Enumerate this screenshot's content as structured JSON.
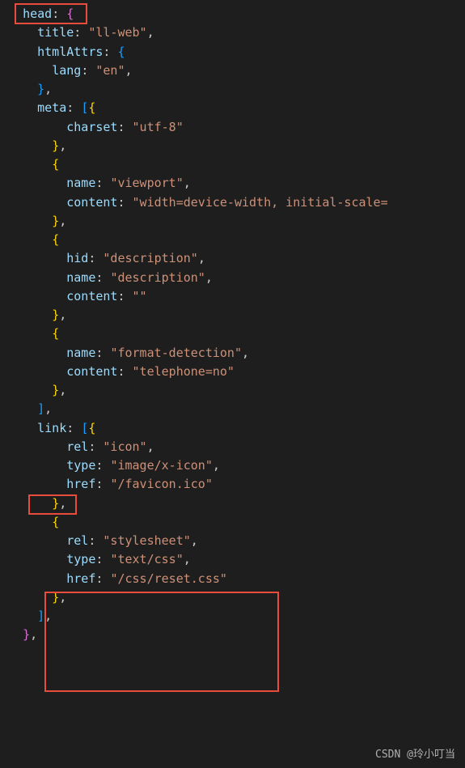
{
  "code": {
    "head_key": "head",
    "title_key": "title",
    "title_val": "\"ll-web\"",
    "htmlAttrs_key": "htmlAttrs",
    "lang_key": "lang",
    "lang_val": "\"en\"",
    "meta_key": "meta",
    "charset_key": "charset",
    "charset_val": "\"utf-8\"",
    "name_key": "name",
    "viewport_val": "\"viewport\"",
    "content_key": "content",
    "viewport_content": "\"width=device-width, initial-scale=",
    "hid_key": "hid",
    "description_val": "\"description\"",
    "empty_val": "\"\"",
    "format_detection_val": "\"format-detection\"",
    "telephone_val": "\"telephone=no\"",
    "link_key": "link",
    "rel_key": "rel",
    "icon_val": "\"icon\"",
    "type_key": "type",
    "xicon_val": "\"image/x-icon\"",
    "href_key": "href",
    "favicon_val": "\"/favicon.ico\"",
    "stylesheet_val": "\"stylesheet\"",
    "textcss_val": "\"text/css\"",
    "reset_val": "\"/css/reset.css\""
  },
  "watermark": "CSDN @玲小叮当"
}
